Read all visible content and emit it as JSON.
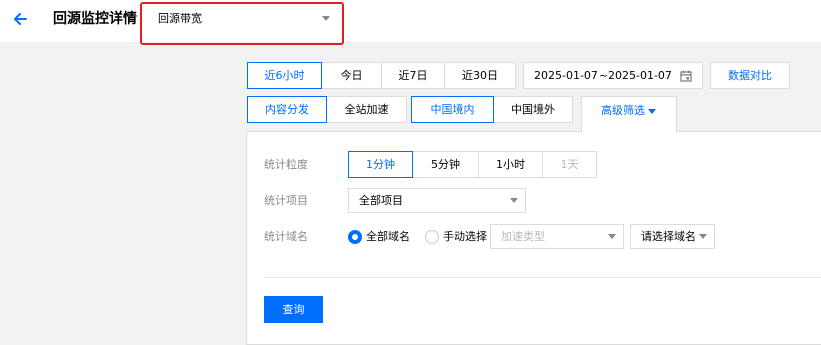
{
  "header": {
    "back_icon": "arrow-left-icon",
    "title": "回源监控详情",
    "metric": {
      "value": "回源带宽"
    }
  },
  "time_range": {
    "options": [
      "近6小时",
      "今日",
      "近7日",
      "近30日"
    ],
    "selected": "近6小时",
    "date_start": "2025-01-07",
    "date_separator": "~",
    "date_end": "2025-01-07",
    "calendar_icon": "calendar-icon",
    "compare_label": "数据对比"
  },
  "service": {
    "options": [
      "内容分发",
      "全站加速"
    ],
    "selected": "内容分发"
  },
  "region": {
    "options": [
      "中国境内",
      "中国境外"
    ],
    "selected": "中国境内"
  },
  "advanced_filter": {
    "label": "高级筛选",
    "expanded": true
  },
  "filters": {
    "granularity": {
      "label": "统计粒度",
      "options": [
        "1分钟",
        "5分钟",
        "1小时",
        "1天"
      ],
      "selected": "1分钟",
      "disabled": [
        "1天"
      ]
    },
    "project": {
      "label": "统计项目",
      "value": "全部项目"
    },
    "domain": {
      "label": "统计域名",
      "all_label": "全部域名",
      "manual_label": "手动选择",
      "selected": "全部域名",
      "type_placeholder": "加速类型",
      "domain_placeholder": "请选择域名"
    }
  },
  "query_label": "查询",
  "colors": {
    "accent": "#006eff",
    "highlight": "#e02020"
  }
}
